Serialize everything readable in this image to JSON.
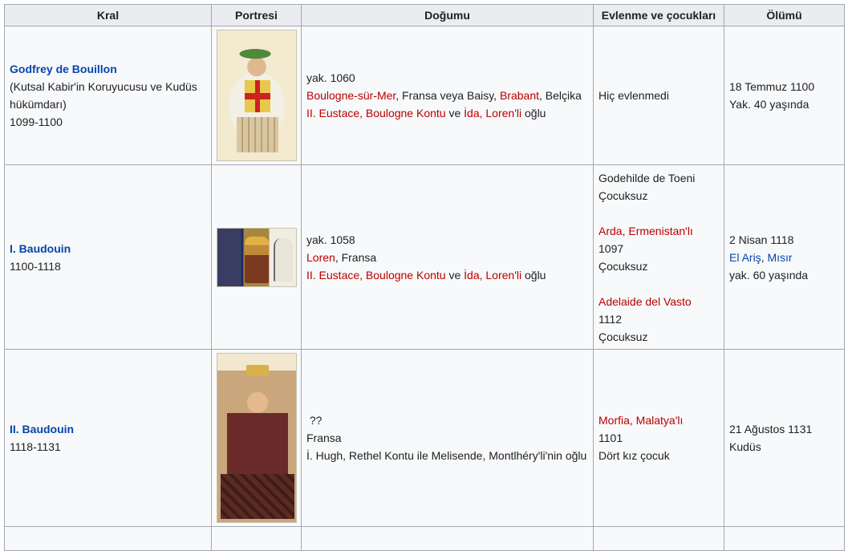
{
  "headers": [
    "Kral",
    "Portresi",
    "Doğumu",
    "Evlenme ve çocukları",
    "Ölümü"
  ],
  "rows": [
    {
      "king_name": "Godfrey de Bouillon",
      "king_title": "(Kutsal Kabir'in Koruyucusu ve Kudüs hükümdarı)",
      "reign": "1099-1100",
      "birth_year": "yak. 1060",
      "birth_place_link1": "Boulogne-sür-Mer",
      "birth_place_mid": ", Fransa veya Baisy, ",
      "birth_place_link2": "Brabant",
      "birth_place_end": ", Belçika",
      "parent1": "II. Eustace, Boulogne Kontu",
      "parent_sep": " ve ",
      "parent2": "İda, Loren'li",
      "parent_end": " oğlu",
      "marriage": "Hiç evlenmedi",
      "death_date": "18 Temmuz 1100",
      "death_age": "Yak. 40 yaşında"
    },
    {
      "king_name": "I. Baudouin",
      "reign": "1100-1118",
      "birth_year": "yak. 1058",
      "birth_place_link1": "Loren",
      "birth_place_end": ", Fransa",
      "parent1": "II. Eustace, Boulogne Kontu",
      "parent_sep": " ve ",
      "parent2": "İda, Loren'li",
      "parent_end": " oğlu",
      "spouse1": "Godehilde de Toeni",
      "spouse1_children": "Çocuksuz",
      "spouse2": "Arda, Ermenistan'lı",
      "spouse2_year": "1097",
      "spouse2_children": "Çocuksuz",
      "spouse3": "Adelaide del Vasto",
      "spouse3_year": "1112",
      "spouse3_children": "Çocuksuz",
      "death_date": "2 Nisan 1118",
      "death_place1": "El Ariş",
      "death_place_sep": ", ",
      "death_place2": "Mısır",
      "death_age": "yak. 60 yaşında"
    },
    {
      "king_name": "II. Baudouin",
      "reign": "1118-1131",
      "birth_year": "??",
      "birth_place": "Fransa",
      "parents": "İ. Hugh, Rethel Kontu ile Melisende, Montlhéry'li'nin oğlu",
      "spouse1": "Morfia, Malatya'lı",
      "spouse1_year": "1101",
      "spouse1_children": "Dört kız çocuk",
      "death_date": "21 Ağustos 1131",
      "death_place": "Kudüs"
    }
  ]
}
